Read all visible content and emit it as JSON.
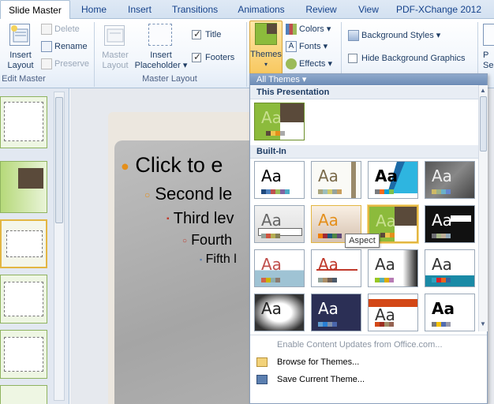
{
  "tabs": [
    "Slide Master",
    "Home",
    "Insert",
    "Transitions",
    "Animations",
    "Review",
    "View",
    "PDF-XChange 2012"
  ],
  "ribbon": {
    "edit_master": {
      "insert_layout": "Insert\nLayout",
      "insert_layout_l1": "Insert",
      "insert_layout_l2": "Layout",
      "delete": "Delete",
      "rename": "Rename",
      "preserve": "Preserve",
      "label": "Edit Master"
    },
    "master_layout": {
      "master_layout_l1": "Master",
      "master_layout_l2": "Layout",
      "insert_placeholder_l1": "Insert",
      "insert_placeholder_l2": "Placeholder",
      "title": "Title",
      "footers": "Footers",
      "label": "Master Layout"
    },
    "edit_theme": {
      "themes": "Themes",
      "colors": "Colors",
      "fonts": "Fonts",
      "effects": "Effects"
    },
    "background": {
      "background_styles": "Background Styles",
      "hide_background_graphics": "Hide Background Graphics"
    },
    "page_setup_l1": "P",
    "page_setup_l2": "Se"
  },
  "slide": {
    "l1": "Click to e",
    "l2": "Second le",
    "l3": "Third lev",
    "l4": "Fourth",
    "l5": "Fifth l"
  },
  "themes_dropdown": {
    "header": "All Themes ▾",
    "this_presentation": "This Presentation",
    "built_in": "Built-In",
    "aa": "Aa",
    "tooltip": "Aspect",
    "menu": {
      "enable_updates": "Enable Content Updates from Office.com...",
      "browse": "Browse for Themes...",
      "save": "Save Current Theme..."
    }
  },
  "colors": {
    "accent_green": "#8cbb3c",
    "selection_gold": "#e3b642",
    "ribbon_text": "#15428b"
  }
}
